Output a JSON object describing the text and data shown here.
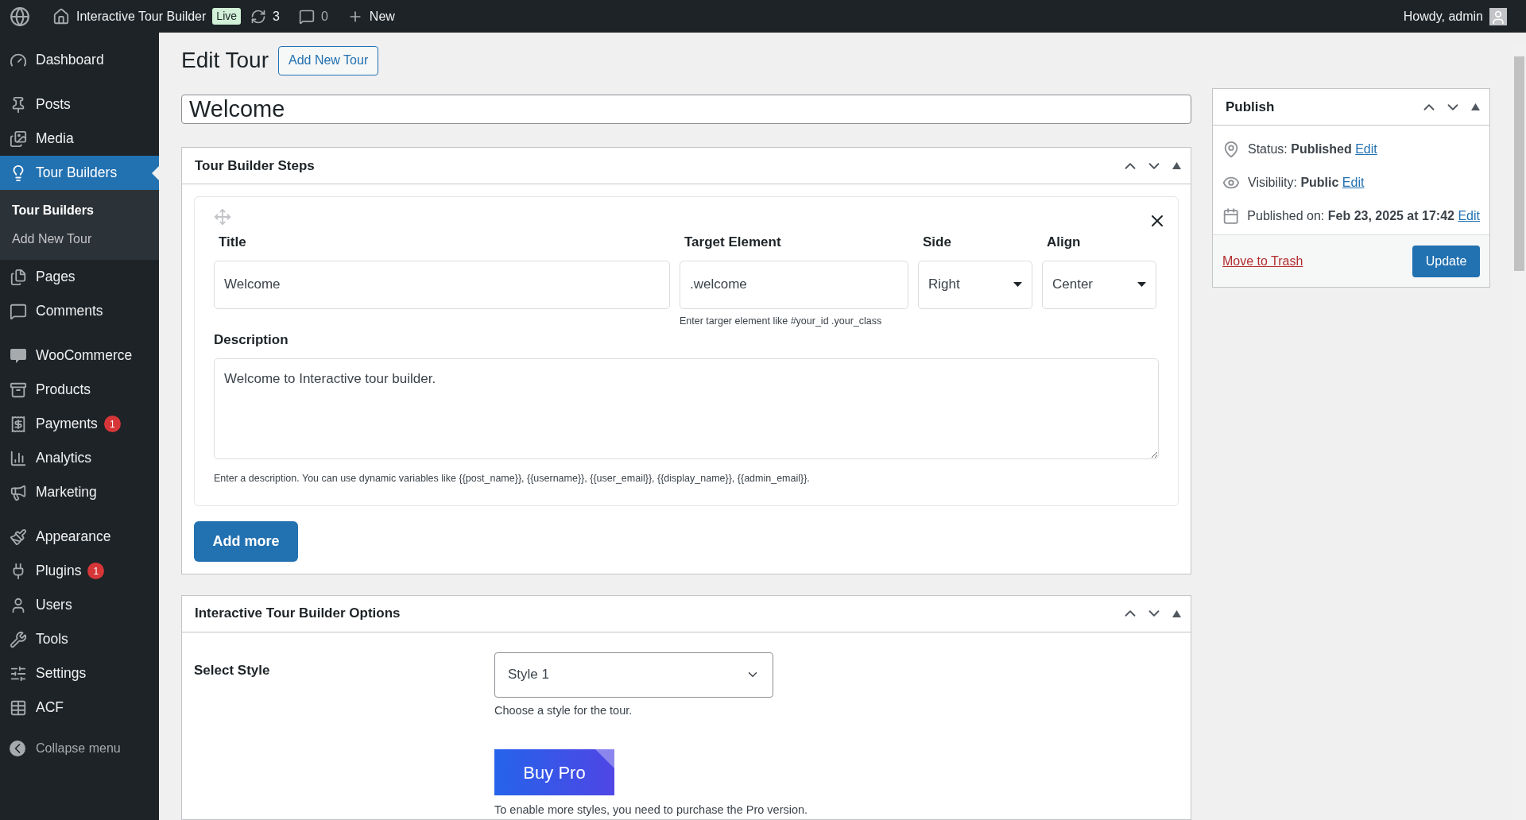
{
  "admin_bar": {
    "site_name": "Interactive Tour Builder",
    "live_badge": "Live",
    "updates": "3",
    "comments": "0",
    "new": "New",
    "greeting": "Howdy, admin"
  },
  "sidebar": {
    "items": [
      {
        "label": "Dashboard",
        "selected": false
      },
      {
        "label": "Posts",
        "selected": false
      },
      {
        "label": "Media",
        "selected": false
      },
      {
        "label": "Tour Builders",
        "selected": true,
        "children": [
          {
            "label": "Tour Builders",
            "selected": true
          },
          {
            "label": "Add New Tour",
            "selected": false
          }
        ]
      },
      {
        "label": "Pages",
        "selected": false
      },
      {
        "label": "Comments",
        "selected": false
      },
      {
        "label": "WooCommerce",
        "selected": false
      },
      {
        "label": "Products",
        "selected": false
      },
      {
        "label": "Payments",
        "selected": false,
        "badge": "1"
      },
      {
        "label": "Analytics",
        "selected": false
      },
      {
        "label": "Marketing",
        "selected": false
      },
      {
        "label": "Appearance",
        "selected": false
      },
      {
        "label": "Plugins",
        "selected": false,
        "badge": "1"
      },
      {
        "label": "Users",
        "selected": false
      },
      {
        "label": "Tools",
        "selected": false
      },
      {
        "label": "Settings",
        "selected": false
      },
      {
        "label": "ACF",
        "selected": false
      }
    ],
    "collapse": "Collapse menu"
  },
  "page": {
    "heading": "Edit Tour",
    "add_new": "Add New Tour",
    "title_value": "Welcome"
  },
  "steps_box": {
    "title": "Tour Builder Steps",
    "step": {
      "title_label": "Title",
      "title_value": "Welcome",
      "target_label": "Target Element",
      "target_value": ".welcome",
      "target_hint": "Enter targer element like #your_id .your_class",
      "side_label": "Side",
      "side_value": "Right",
      "align_label": "Align",
      "align_value": "Center",
      "description_label": "Description",
      "description_value": "Welcome to Interactive tour builder.",
      "description_hint": "Enter a description. You can use dynamic variables like {{post_name}}, {{username}}, {{user_email}}, {{display_name}}, {{admin_email}}."
    },
    "add_more": "Add more"
  },
  "options_box": {
    "title": "Interactive Tour Builder Options",
    "style_label": "Select Style",
    "style_value": "Style 1",
    "style_hint": "Choose a style for the tour.",
    "buy_pro": "Buy Pro",
    "pro_hint": "To enable more styles, you need to purchase the Pro version."
  },
  "publish": {
    "title": "Publish",
    "rows": [
      {
        "label": "Status: ",
        "value": "Published",
        "link": "Edit"
      },
      {
        "label": "Visibility: ",
        "value": "Public",
        "link": "Edit"
      },
      {
        "label": "Published on: ",
        "value": "Feb 23, 2025 at 17:42",
        "link": "Edit"
      }
    ],
    "trash": "Move to Trash",
    "update": "Update"
  }
}
